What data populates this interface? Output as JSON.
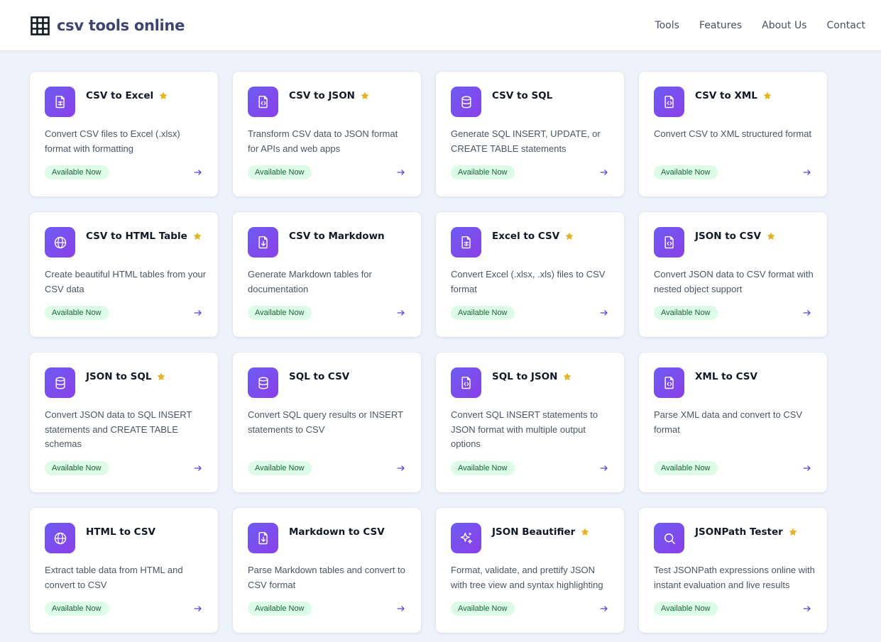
{
  "brand": {
    "name": "csv tools online",
    "icon": "grid-icon"
  },
  "nav": [
    "Tools",
    "Features",
    "About Us",
    "Contact"
  ],
  "colors": {
    "accent_gradient_start": "#6d5cf2",
    "accent_gradient_end": "#8b3fe8",
    "star": "#e6b422",
    "badge_bg": "#dcfce7",
    "badge_text": "#166534",
    "arrow": "#4f46e5"
  },
  "badge_label": "Available Now",
  "rows": [
    [
      {
        "title": "CSV to Excel",
        "star": true,
        "icon": "file-spreadsheet-icon",
        "desc": "Convert CSV files to Excel (.xlsx) format with formatting"
      },
      {
        "title": "CSV to JSON",
        "star": true,
        "icon": "file-code-icon",
        "desc": "Transform CSV data to JSON format for APIs and web apps"
      },
      {
        "title": "CSV to SQL",
        "star": false,
        "icon": "database-icon",
        "desc": "Generate SQL INSERT, UPDATE, or CREATE TABLE statements"
      },
      {
        "title": "CSV to XML",
        "star": true,
        "icon": "file-code-icon",
        "desc": "Convert CSV to XML structured format"
      }
    ],
    [
      {
        "title": "CSV to HTML Table",
        "star": true,
        "icon": "globe-icon",
        "desc": "Create beautiful HTML tables from your CSV data"
      },
      {
        "title": "CSV to Markdown",
        "star": false,
        "icon": "file-download-icon",
        "desc": "Generate Markdown tables for documentation"
      },
      {
        "title": "Excel to CSV",
        "star": true,
        "icon": "file-spreadsheet-icon",
        "desc": "Convert Excel (.xlsx, .xls) files to CSV format"
      },
      {
        "title": "JSON to CSV",
        "star": true,
        "icon": "file-code-icon",
        "desc": "Convert JSON data to CSV format with nested object support"
      }
    ],
    [
      {
        "title": "JSON to SQL",
        "star": true,
        "icon": "database-icon",
        "desc": "Convert JSON data to SQL INSERT statements and CREATE TABLE schemas"
      },
      {
        "title": "SQL to CSV",
        "star": false,
        "icon": "database-icon",
        "desc": "Convert SQL query results or INSERT statements to CSV"
      },
      {
        "title": "SQL to JSON",
        "star": true,
        "icon": "file-code-icon",
        "desc": "Convert SQL INSERT statements to JSON format with multiple output options"
      },
      {
        "title": "XML to CSV",
        "star": false,
        "icon": "file-code-icon",
        "desc": "Parse XML data and convert to CSV format"
      }
    ],
    [
      {
        "title": "HTML to CSV",
        "star": false,
        "icon": "globe-icon",
        "desc": "Extract table data from HTML and convert to CSV"
      },
      {
        "title": "Markdown to CSV",
        "star": false,
        "icon": "file-download-icon",
        "desc": "Parse Markdown tables and convert to CSV format"
      },
      {
        "title": "JSON Beautifier",
        "star": true,
        "icon": "sparkles-icon",
        "desc": "Format, validate, and prettify JSON with tree view and syntax highlighting"
      },
      {
        "title": "JSONPath Tester",
        "star": true,
        "icon": "search-icon",
        "desc": "Test JSONPath expressions online with instant evaluation and live results"
      }
    ]
  ]
}
